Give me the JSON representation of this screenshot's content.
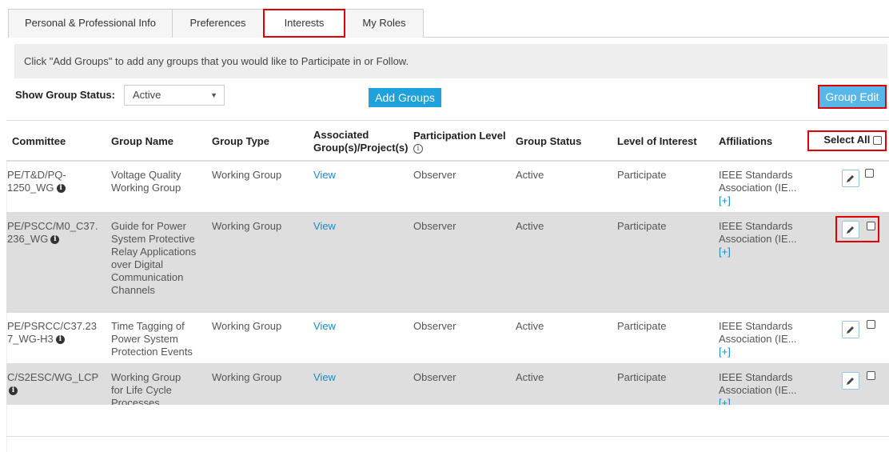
{
  "tabs": [
    {
      "label": "Personal & Professional Info",
      "active": false
    },
    {
      "label": "Preferences",
      "active": false
    },
    {
      "label": "Interests",
      "active": true
    },
    {
      "label": "My Roles",
      "active": false
    }
  ],
  "banner": {
    "text": "Click \"Add Groups\" to add any groups that you would like to Participate in or Follow."
  },
  "controls": {
    "status_label": "Show Group Status:",
    "status_value": "Active",
    "add_groups_label": "Add Groups",
    "group_edit_label": "Group Edit"
  },
  "table": {
    "headers": {
      "committee": "Committee",
      "group_name": "Group Name",
      "group_type": "Group Type",
      "associated_1": "Associated",
      "associated_2": "Group(s)/Project(s)",
      "participation": "Participation Level",
      "group_status": "Group Status",
      "level_of_interest": "Level of Interest",
      "affiliations": "Affiliations",
      "select_all": "Select All"
    },
    "rows": [
      {
        "committee_1": "PE/T&D/PQ-",
        "committee_2": "1250_WG",
        "group_name": [
          "Voltage Quality",
          "Working Group"
        ],
        "group_type": "Working Group",
        "associated": "View",
        "participation": "Observer",
        "status": "Active",
        "interest": "Participate",
        "affiliation_1": "IEEE Standards",
        "affiliation_2": "Association (IE...",
        "affiliation_more": "[+]"
      },
      {
        "committee_1": "PE/PSCC/M0_C37.",
        "committee_2": "236_WG",
        "group_name": [
          "Guide for Power",
          "System Protective",
          "Relay Applications",
          "over Digital",
          "Communication",
          "Channels"
        ],
        "group_type": "Working Group",
        "associated": "View",
        "participation": "Observer",
        "status": "Active",
        "interest": "Participate",
        "affiliation_1": "IEEE Standards",
        "affiliation_2": "Association (IE...",
        "affiliation_more": "[+]"
      },
      {
        "committee_1": "PE/PSRCC/C37.23",
        "committee_2": "7_WG-H3",
        "group_name": [
          "Time Tagging of",
          "Power System",
          "Protection Events"
        ],
        "group_type": "Working Group",
        "associated": "View",
        "participation": "Observer",
        "status": "Active",
        "interest": "Participate",
        "affiliation_1": "IEEE Standards",
        "affiliation_2": "Association (IE...",
        "affiliation_more": "[+]"
      },
      {
        "committee_1": "C/S2ESC/WG_LCP",
        "committee_2": "",
        "group_name": [
          "Working Group",
          "for Life Cycle",
          "Processes"
        ],
        "group_type": "Working Group",
        "associated": "View",
        "participation": "Observer",
        "status": "Active",
        "interest": "Participate",
        "affiliation_1": "IEEE Standards",
        "affiliation_2": "Association (IE...",
        "affiliation_more": "[+]"
      }
    ]
  },
  "colors": {
    "accent_blue": "#1fa1dc",
    "link_blue": "#1a8ac8",
    "highlight_red": "#e00000",
    "row_shade": "#dedede"
  }
}
